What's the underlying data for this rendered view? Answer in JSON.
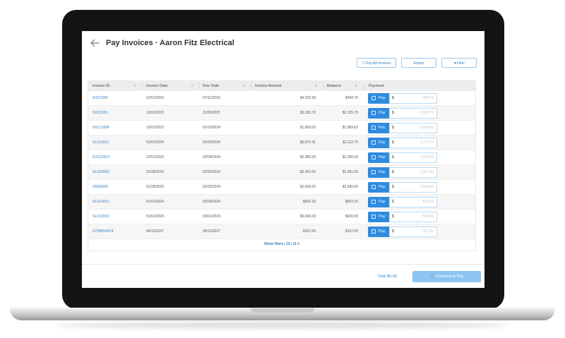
{
  "header": {
    "title": "Pay Invoices · Aaron Fitz Electrical"
  },
  "actions": {
    "pay_all": "Pay All Invoices",
    "export": "Export",
    "filter": "Filter"
  },
  "table": {
    "columns": [
      "Invoice ID",
      "Invoice Date",
      "Due Date",
      "Invoice Amount",
      "Balance",
      "Payment"
    ],
    "pay_label": "Pay",
    "currency_symbol": "$",
    "rows": [
      {
        "id": "SVC1000",
        "invoice_date": "12/01/2023",
        "due_date": "07/11/2023",
        "amount": "$4,322.98",
        "balance": "$468.70",
        "payment": "468.70"
      },
      {
        "id": "SVC1001",
        "invoice_date": "12/01/2023",
        "due_date": "11/05/2023",
        "amount": "$2,155.79",
        "balance": "$2,155.79",
        "payment": "2,155.79"
      },
      {
        "id": "SVC11004",
        "invoice_date": "12/01/2023",
        "due_date": "02/10/2024",
        "amount": "$1,859.63",
        "balance": "$1,859.63",
        "payment": "1,859.63"
      },
      {
        "id": "SLS11012",
        "invoice_date": "01/01/2024",
        "due_date": "02/20/2024",
        "amount": "$5,872.41",
        "balance": "$2,112.70",
        "payment": "2,112.70"
      },
      {
        "id": "SVC11013",
        "invoice_date": "12/01/2023",
        "due_date": "02/04/2024",
        "amount": "$2,356.09",
        "balance": "$2,356.09",
        "payment": "2,356.09"
      },
      {
        "id": "SLS20000",
        "invoice_date": "01/28/2025",
        "due_date": "02/25/2024",
        "amount": "$2,461.00",
        "balance": "$2,461.00",
        "payment": "2,461.00"
      },
      {
        "id": "DNS0005",
        "invoice_date": "01/28/2025",
        "due_date": "02/25/2024",
        "amount": "$2,500.00",
        "balance": "$2,500.00",
        "payment": "2,500.00"
      },
      {
        "id": "SLS11015",
        "invoice_date": "01/01/2024",
        "due_date": "02/26/2024",
        "amount": "$833.33",
        "balance": "$833.33",
        "payment": "833.33"
      },
      {
        "id": "SLS11016",
        "invoice_date": "01/01/2024",
        "due_date": "03/01/2024",
        "amount": "$5,000.00",
        "balance": "$600.00",
        "payment": "600.00"
      },
      {
        "id": "STDINV2474",
        "invoice_date": "04/12/2027",
        "due_date": "05/12/2027",
        "amount": "$107.00",
        "balance": "$107.00",
        "payment": "107.00"
      }
    ],
    "show_more": "Show More | 10 / 11 ▾"
  },
  "footer": {
    "total": "Total $0.00",
    "continue": "Continue to Pay"
  },
  "colors": {
    "accent": "#2f8be0",
    "link": "#2d7fc4",
    "continue_disabled": "#8ec4f0",
    "frame": "#141414"
  }
}
